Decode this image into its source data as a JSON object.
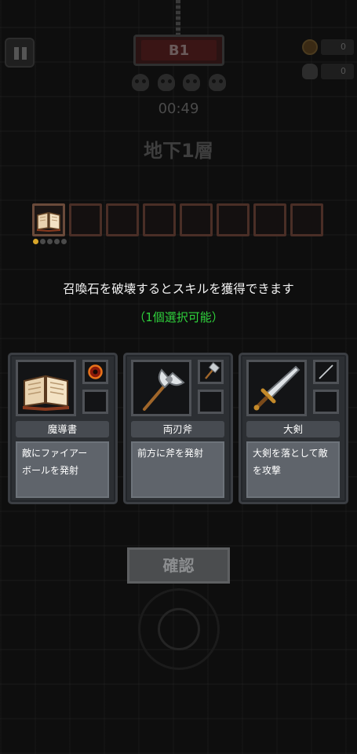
{
  "hud": {
    "floor_badge": "B1",
    "timer": "00:49",
    "floor_title": "地下1層",
    "coins": "0",
    "kills": "0"
  },
  "inventory": {
    "slots": 8,
    "equipped": [
      "book-icon"
    ]
  },
  "dialog": {
    "notice": "召喚石を破壊するとスキルを獲得できます",
    "selectable": "（1個選択可能）"
  },
  "cards": [
    {
      "icon": "spellbook-icon",
      "side_icon": "fire-ring-icon",
      "name": "魔導書",
      "desc": "敵にファイアーボールを発射",
      "desc_lines": [
        "敵にファイアー",
        "ボールを発射"
      ]
    },
    {
      "icon": "double-axe-icon",
      "side_icon": "hammer-icon",
      "name": "両刃斧",
      "desc": "前方に斧を発射",
      "desc_lines": [
        "前方に斧を発射"
      ]
    },
    {
      "icon": "greatsword-icon",
      "side_icon": "needle-icon",
      "name": "大剣",
      "desc": "大剣を落として敵を攻撃",
      "desc_lines": [
        "大剣を落として敵",
        "を攻撃"
      ]
    }
  ],
  "confirm_label": "確認",
  "colors": {
    "accent_green": "#2fd33c",
    "card_bg": "#2c2f33"
  }
}
